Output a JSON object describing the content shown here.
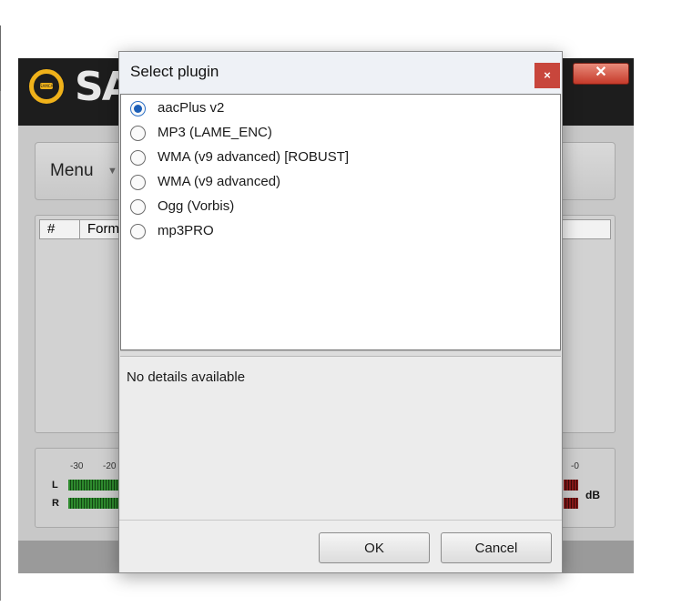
{
  "background_app": {
    "logo_text": "SA",
    "logo_badge": "SAMCAST",
    "close_glyph": "✕",
    "menu_label": "Menu",
    "menu_arrow": "▼",
    "list_headers": [
      "#",
      "Form"
    ],
    "meter": {
      "scale_left": [
        "-30",
        "-20"
      ],
      "scale_right": "-0",
      "channels": [
        "L",
        "R"
      ],
      "unit": "dB"
    }
  },
  "dialog": {
    "title": "Select plugin",
    "close_glyph": "×",
    "plugins": [
      {
        "label": "aacPlus v2",
        "selected": true
      },
      {
        "label": "MP3 (LAME_ENC)",
        "selected": false
      },
      {
        "label": "WMA (v9 advanced) [ROBUST]",
        "selected": false
      },
      {
        "label": "WMA (v9 advanced)",
        "selected": false
      },
      {
        "label": "Ogg (Vorbis)",
        "selected": false
      },
      {
        "label": "mp3PRO",
        "selected": false
      }
    ],
    "details_text": "No details available",
    "ok_label": "OK",
    "cancel_label": "Cancel"
  },
  "colors": {
    "accent_radio": "#1c5fb8",
    "close_red": "#c8463c",
    "logo_yellow": "#f0b21a"
  },
  "icons": {
    "radio_selected": "radio-selected-icon",
    "radio_unselected": "radio-unselected-icon",
    "close": "close-icon",
    "dropdown": "chevron-down-icon"
  }
}
